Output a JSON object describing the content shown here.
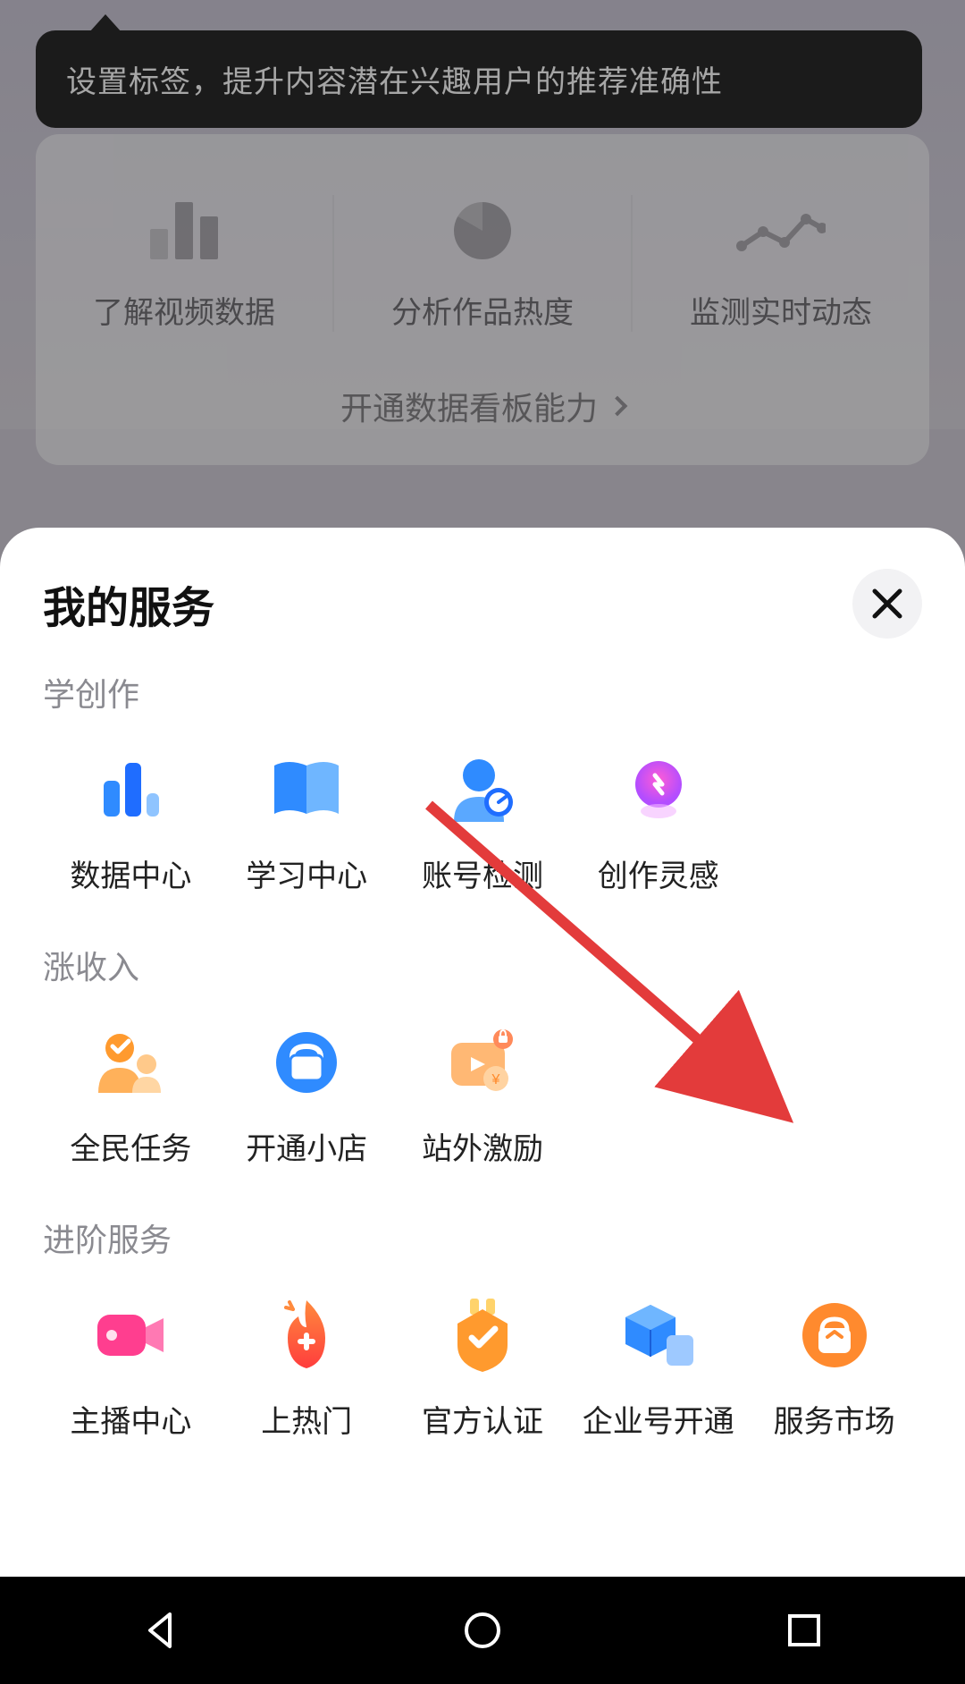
{
  "tooltip": {
    "text": "设置标签，提升内容潜在兴趣用户的推荐准确性"
  },
  "card": {
    "items": [
      {
        "label": "了解视频数据",
        "icon": "bar-chart-icon"
      },
      {
        "label": "分析作品热度",
        "icon": "pie-chart-icon"
      },
      {
        "label": "监测实时动态",
        "icon": "line-chart-icon"
      }
    ],
    "cta": "开通数据看板能力"
  },
  "sheet": {
    "title": "我的服务",
    "sections": [
      {
        "label": "学创作",
        "items": [
          {
            "name": "data-center",
            "label": "数据中心",
            "icon": "bar-blue-icon"
          },
          {
            "name": "study-center",
            "label": "学习中心",
            "icon": "book-icon"
          },
          {
            "name": "account-check",
            "label": "账号检测",
            "icon": "person-gauge-icon"
          },
          {
            "name": "inspiration",
            "label": "创作灵感",
            "icon": "lightbulb-icon"
          }
        ]
      },
      {
        "label": "涨收入",
        "items": [
          {
            "name": "all-task",
            "label": "全民任务",
            "icon": "people-orange-icon"
          },
          {
            "name": "open-shop",
            "label": "开通小店",
            "icon": "shop-icon"
          },
          {
            "name": "off-site",
            "label": "站外激励",
            "icon": "lock-media-icon"
          }
        ]
      },
      {
        "label": "进阶服务",
        "items": [
          {
            "name": "anchor-center",
            "label": "主播中心",
            "icon": "camera-pink-icon"
          },
          {
            "name": "go-hot",
            "label": "上热门",
            "icon": "fire-icon"
          },
          {
            "name": "official-cert",
            "label": "官方认证",
            "icon": "badge-icon"
          },
          {
            "name": "enterprise",
            "label": "企业号开通",
            "icon": "cube-icon"
          },
          {
            "name": "service-market",
            "label": "服务市场",
            "icon": "bag-orange-icon"
          }
        ]
      }
    ]
  },
  "annotation": {
    "arrow_from": "账号检测",
    "arrow_to": "服务市场"
  }
}
